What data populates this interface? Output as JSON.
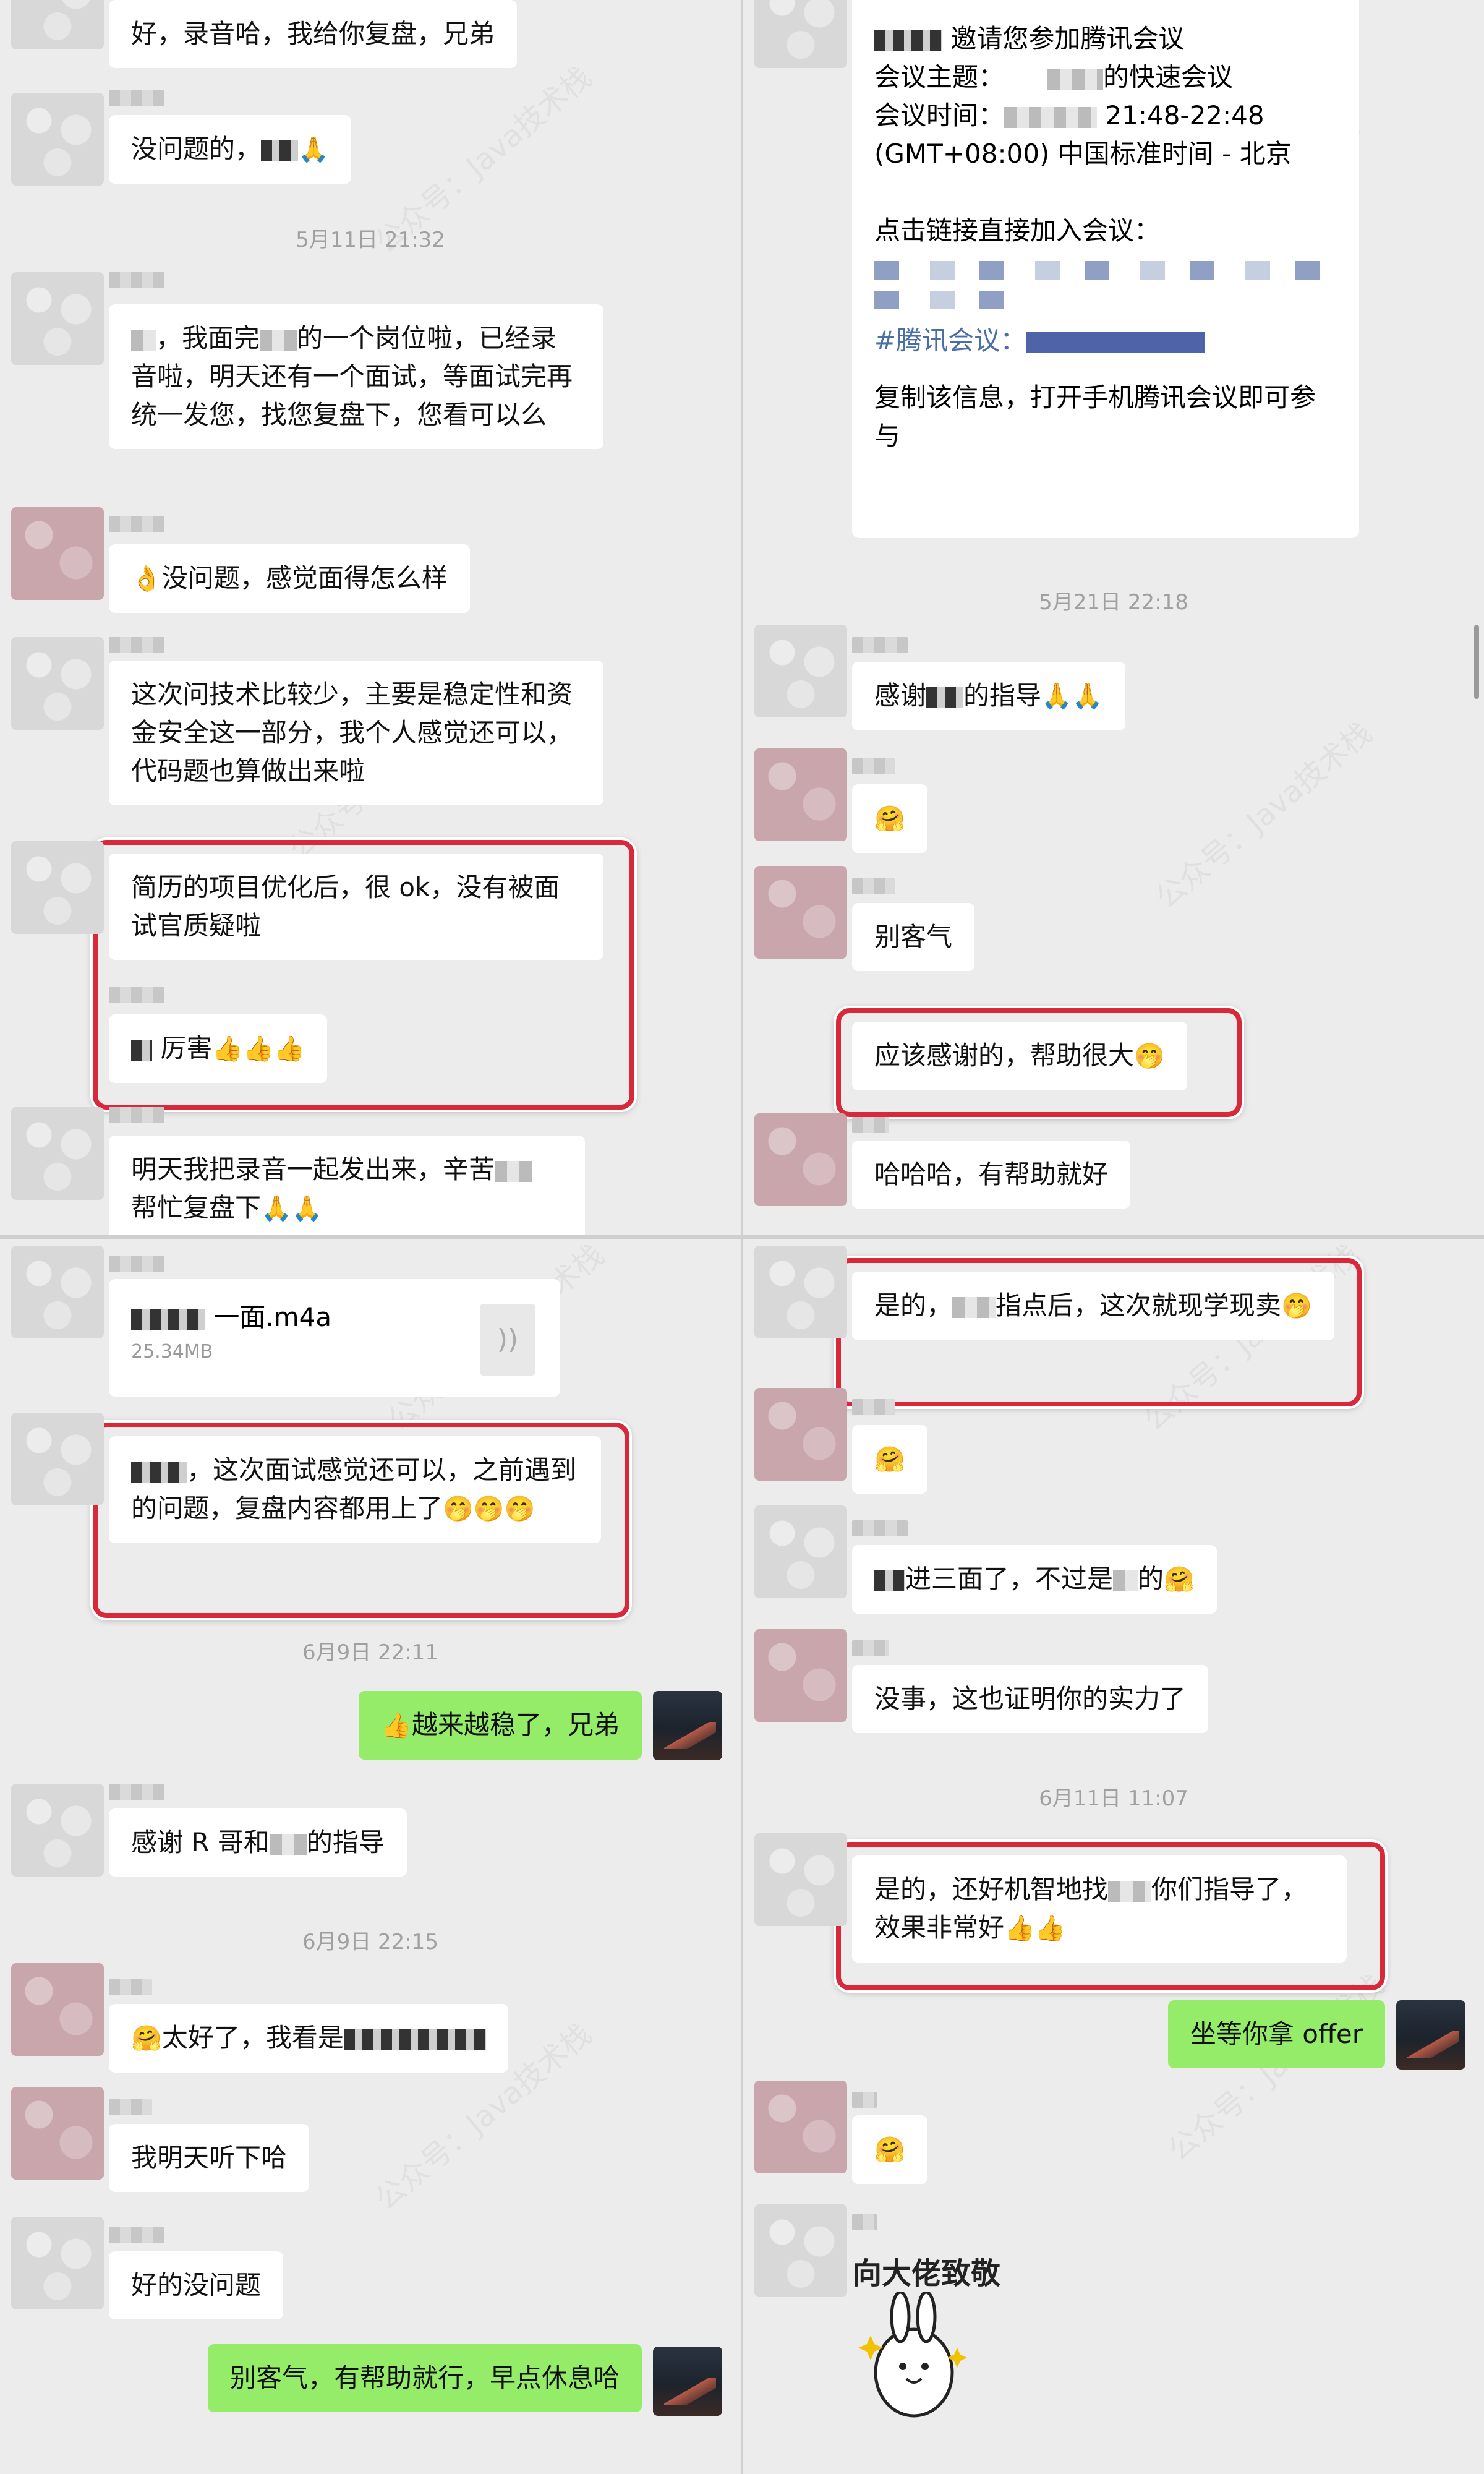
{
  "tl": {
    "m1": "好，录音哈，我给你复盘，兄弟",
    "m2": "没问题的，",
    "time1": "5月11日 21:32",
    "m3a": "，我面完",
    "m3b": "的一个岗位啦，已经录音啦，明天还有一个面试，等面试完再统一发您，找您复盘下，您看可以么",
    "m4": "没问题，感觉面得怎么样",
    "m5": "这次问技术比较少，主要是稳定性和资金安全这一部分，我个人感觉还可以，代码题也算做出来啦",
    "m6": "简历的项目优化后，很 ok，没有被面试官质疑啦",
    "m7": "厉害",
    "m8a": "明天我把录音一起发出来，辛苦",
    "m8b": "帮忙复盘下"
  },
  "tr": {
    "i1": "邀请您参加腾讯会议",
    "i2": "会议主题：",
    "i2b": "的快速会议",
    "i3": "会议时间：",
    "i3b": "21:48-22:48",
    "i4": "(GMT+08:00) 中国标准时间 - 北京",
    "i5": "点击链接直接加入会议：",
    "i6": "#腾讯会议：",
    "i7": "复制该信息，打开手机腾讯会议即可参与",
    "time1": "5月21日 22:18",
    "m1a": "感谢",
    "m1b": "的指导",
    "m3": "别客气",
    "m4": "应该感谢的，帮助很大",
    "m5": "哈哈哈，有帮助就好"
  },
  "bl": {
    "file_name": "一面.m4a",
    "file_size": "25.34MB",
    "m1": "，这次面试感觉还可以，之前遇到的问题，复盘内容都用上了",
    "time1": "6月9日 22:11",
    "m2": "越来越稳了，兄弟",
    "m3a": "感谢 R 哥和",
    "m3b": "的指导",
    "time2": "6月9日 22:15",
    "m4": "太好了，我看是",
    "m5": "我明天听下哈",
    "m6": "好的没问题",
    "m7": "别客气，有帮助就行，早点休息哈"
  },
  "br": {
    "m1a": "是的，",
    "m1b": "指点后，这次就现学现卖",
    "m3a": "进三面了，不过是",
    "m3b": "的",
    "m4": "没事，这也证明你的实力了",
    "time1": "6月11日 11:07",
    "m5a": "是的，还好机智地找",
    "m5b": "你们指导了，效果非常好",
    "m6": "坐等你拿 offer",
    "sticker": "向大佬致敬"
  },
  "watermark": "公众号：Java技术栈",
  "colors": {
    "highlight": "#d9283a",
    "bubble_me": "#95ec69",
    "bubble_other": "#ffffff",
    "time": "#a0a0a0"
  },
  "icons": {
    "emoji_pray": "🙏",
    "emoji_ok": "👌",
    "emoji_thumbs": "👍",
    "emoji_smile": "🤗",
    "emoji_smirk": "🤭",
    "file": "audio-file-icon"
  }
}
